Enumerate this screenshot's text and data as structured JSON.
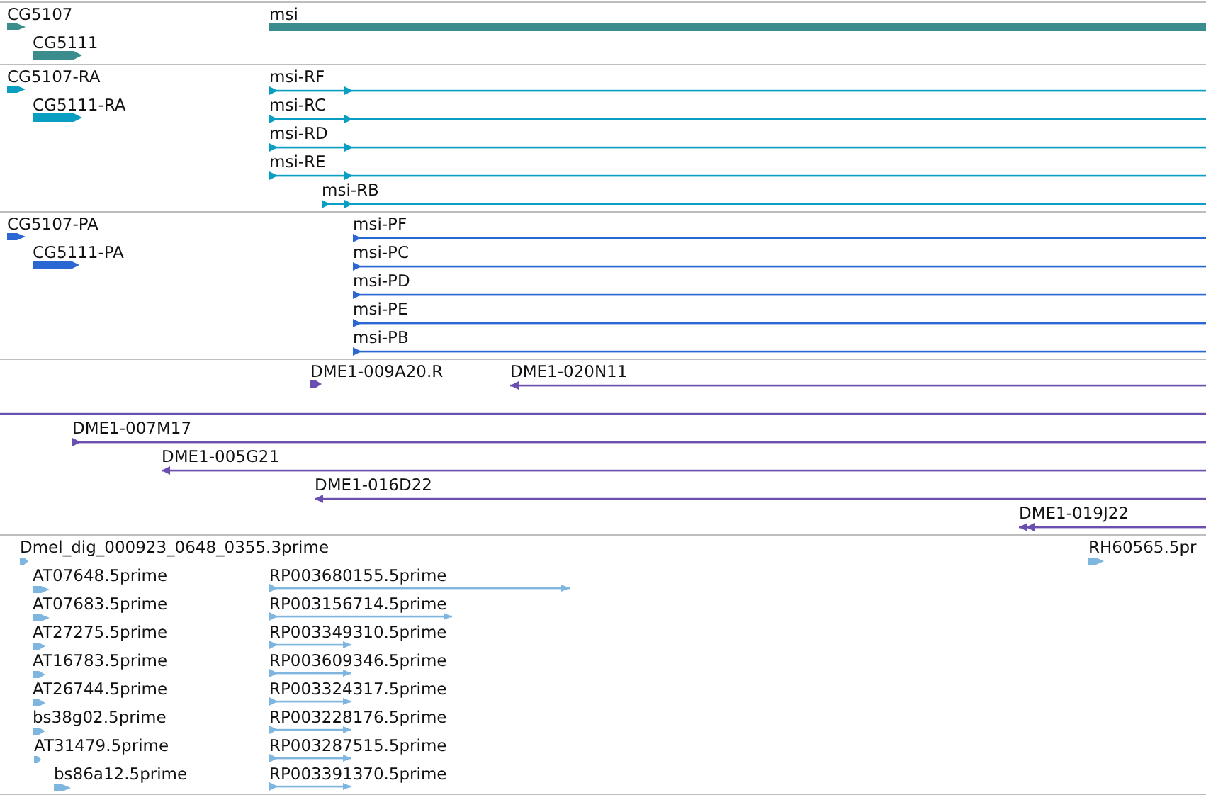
{
  "tracks": [
    {
      "color": "#3b8c8c",
      "features": [
        {
          "label": "CG5107",
          "kind": "bar",
          "reverse": false
        },
        {
          "label": "msi",
          "kind": "bar",
          "reverse": false
        },
        {
          "label": "CG5111",
          "kind": "bar",
          "reverse": false
        }
      ]
    },
    {
      "color": "#0a9ec2",
      "features": [
        {
          "label": "CG5107-RA",
          "kind": "bar",
          "reverse": false
        },
        {
          "label": "msi-RF",
          "kind": "line",
          "reverse": false
        },
        {
          "label": "CG5111-RA",
          "kind": "bar",
          "reverse": false
        },
        {
          "label": "msi-RC",
          "kind": "line",
          "reverse": false
        },
        {
          "label": "msi-RD",
          "kind": "line",
          "reverse": false
        },
        {
          "label": "msi-RE",
          "kind": "line",
          "reverse": false
        },
        {
          "label": "msi-RB",
          "kind": "line",
          "reverse": false
        }
      ]
    },
    {
      "color": "#2b67d2",
      "features": [
        {
          "label": "CG5107-PA",
          "kind": "bar",
          "reverse": false
        },
        {
          "label": "msi-PF",
          "kind": "line",
          "reverse": false
        },
        {
          "label": "CG5111-PA",
          "kind": "bar",
          "reverse": false
        },
        {
          "label": "msi-PC",
          "kind": "line",
          "reverse": false
        },
        {
          "label": "msi-PD",
          "kind": "line",
          "reverse": false
        },
        {
          "label": "msi-PE",
          "kind": "line",
          "reverse": false
        },
        {
          "label": "msi-PB",
          "kind": "line",
          "reverse": false
        }
      ]
    },
    {
      "color": "#6b4faf",
      "features": [
        {
          "label": "DME1-009A20.R",
          "kind": "bar",
          "reverse": false
        },
        {
          "label": "DME1-020N11",
          "kind": "line",
          "reverse": true
        },
        {
          "kind": "line"
        },
        {
          "label": "DME1-007M17",
          "kind": "line",
          "reverse": false
        },
        {
          "label": "DME1-005G21",
          "kind": "line",
          "reverse": true
        },
        {
          "label": "DME1-016D22",
          "kind": "line",
          "reverse": true
        },
        {
          "label": "DME1-019J22",
          "kind": "line",
          "reverse": true
        }
      ]
    },
    {
      "color": "#7fb6df",
      "features": [
        {
          "label": "Dmel_dig_000923_0648_0355.3prime",
          "kind": "bar",
          "reverse": false
        },
        {
          "label": "RH60565.5pr",
          "kind": "bar",
          "reverse": false
        },
        {
          "label": "AT07648.5prime",
          "kind": "bar",
          "reverse": false
        },
        {
          "label": "RP003680155.5prime",
          "kind": "line",
          "reverse": false
        },
        {
          "label": "AT07683.5prime",
          "kind": "bar",
          "reverse": false
        },
        {
          "label": "RP003156714.5prime",
          "kind": "line",
          "reverse": false
        },
        {
          "label": "AT27275.5prime",
          "kind": "bar",
          "reverse": false
        },
        {
          "label": "RP003349310.5prime",
          "kind": "line",
          "reverse": false
        },
        {
          "label": "AT16783.5prime",
          "kind": "bar",
          "reverse": false
        },
        {
          "label": "RP003609346.5prime",
          "kind": "line",
          "reverse": false
        },
        {
          "label": "AT26744.5prime",
          "kind": "bar",
          "reverse": false
        },
        {
          "label": "RP003324317.5prime",
          "kind": "line",
          "reverse": false
        },
        {
          "label": "bs38g02.5prime",
          "kind": "bar",
          "reverse": false
        },
        {
          "label": "RP003228176.5prime",
          "kind": "line",
          "reverse": false
        },
        {
          "label": "AT31479.5prime",
          "kind": "bar",
          "reverse": false
        },
        {
          "label": "RP003287515.5prime",
          "kind": "line",
          "reverse": false
        },
        {
          "label": "bs86a12.5prime",
          "kind": "bar",
          "reverse": false
        },
        {
          "label": "RP003391370.5prime",
          "kind": "line",
          "reverse": false
        }
      ]
    }
  ]
}
